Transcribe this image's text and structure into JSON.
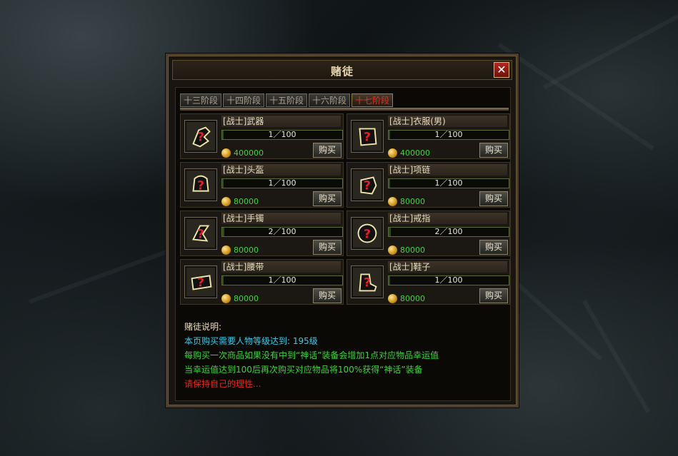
{
  "window": {
    "title": "赌徒",
    "close_icon": "close-x-icon",
    "accent_close": "#b6271c"
  },
  "tabs": [
    {
      "label": "十三阶段",
      "active": false
    },
    {
      "label": "十四阶段",
      "active": false
    },
    {
      "label": "十五阶段",
      "active": false
    },
    {
      "label": "十六阶段",
      "active": false
    },
    {
      "label": "十七阶段",
      "active": true
    }
  ],
  "items": [
    {
      "name": "[战士]武器",
      "progress": "1／100",
      "progress_value": 0.01,
      "price": "400000",
      "buy": "购买",
      "icon": "mystery-weapon-icon"
    },
    {
      "name": "[战士]衣服(男)",
      "progress": "1／100",
      "progress_value": 0.01,
      "price": "400000",
      "buy": "购买",
      "icon": "mystery-armor-icon"
    },
    {
      "name": "[战士]头盔",
      "progress": "1／100",
      "progress_value": 0.01,
      "price": "80000",
      "buy": "购买",
      "icon": "mystery-helmet-icon"
    },
    {
      "name": "[战士]项链",
      "progress": "1／100",
      "progress_value": 0.01,
      "price": "80000",
      "buy": "购买",
      "icon": "mystery-necklace-icon"
    },
    {
      "name": "[战士]手镯",
      "progress": "2／100",
      "progress_value": 0.02,
      "price": "80000",
      "buy": "购买",
      "icon": "mystery-bracelet-icon"
    },
    {
      "name": "[战士]戒指",
      "progress": "2／100",
      "progress_value": 0.02,
      "price": "80000",
      "buy": "购买",
      "icon": "mystery-ring-icon"
    },
    {
      "name": "[战士]腰带",
      "progress": "1／100",
      "progress_value": 0.01,
      "price": "80000",
      "buy": "购买",
      "icon": "mystery-belt-icon"
    },
    {
      "name": "[战士]鞋子",
      "progress": "1／100",
      "progress_value": 0.01,
      "price": "80000",
      "buy": "购买",
      "icon": "mystery-boots-icon"
    }
  ],
  "description": {
    "heading": "赌徒说明:",
    "lines": [
      {
        "text": "本页购买需要人物等级达到: 195级",
        "color": "#3ec8e8"
      },
      {
        "text": "每购买一次商品如果没有中到“神话”装备会增加1点对应物品幸运值",
        "color": "#3ed23e"
      },
      {
        "text": "当幸运值达到100后再次购买对应物品将100%获得“神话”装备",
        "color": "#3ed23e"
      },
      {
        "text": "请保持自己的理性...",
        "color": "#e02a1e"
      }
    ],
    "heading_color": "#e8dcc2"
  }
}
